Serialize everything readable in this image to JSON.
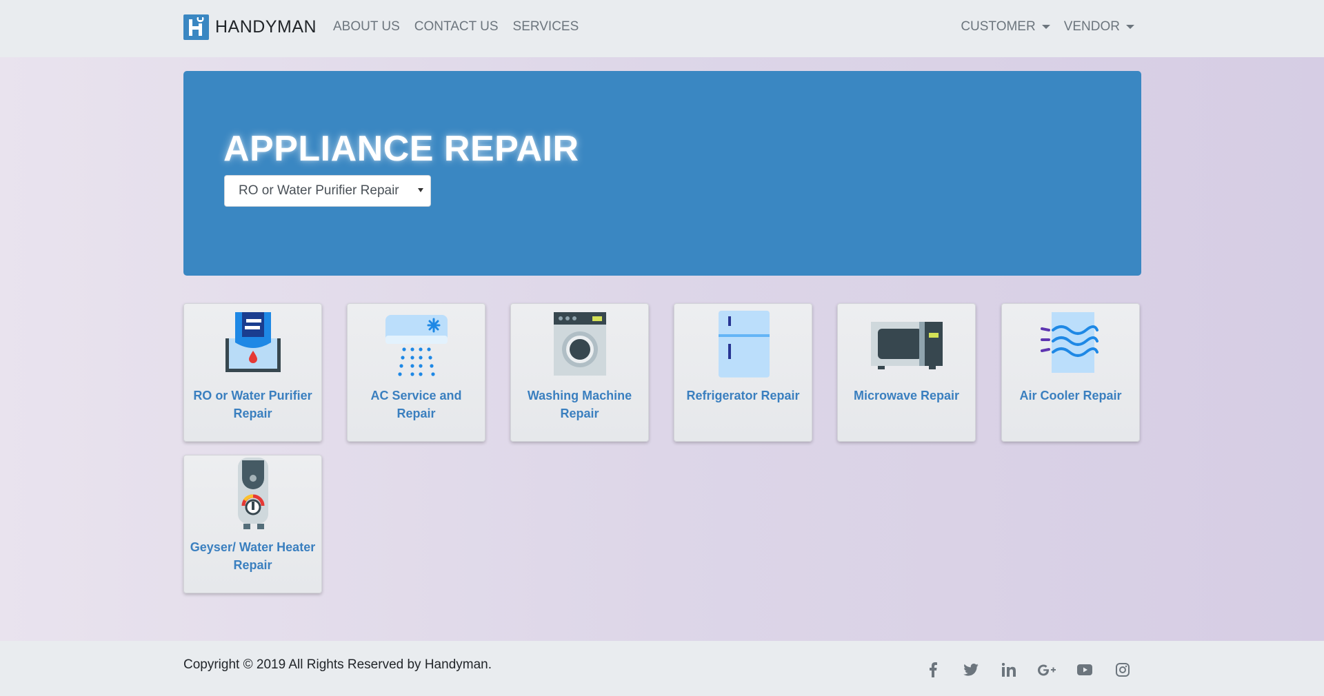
{
  "navbar": {
    "brand": "HANDYMAN",
    "links": [
      "ABOUT US",
      "CONTACT US",
      "SERVICES"
    ],
    "dropdowns": [
      "CUSTOMER",
      "VENDOR"
    ]
  },
  "hero": {
    "title": "APPLIANCE REPAIR",
    "select_value": "RO or Water Purifier Repair"
  },
  "services": [
    {
      "label": "RO or Water Purifier Repair",
      "icon": "water-purifier-icon"
    },
    {
      "label": "AC Service and Repair",
      "icon": "air-conditioner-icon"
    },
    {
      "label": "Washing Machine Repair",
      "icon": "washing-machine-icon"
    },
    {
      "label": "Refrigerator Repair",
      "icon": "refrigerator-icon"
    },
    {
      "label": "Microwave Repair",
      "icon": "microwave-icon"
    },
    {
      "label": "Air Cooler Repair",
      "icon": "air-cooler-icon"
    },
    {
      "label": "Geyser/ Water Heater Repair",
      "icon": "water-heater-icon"
    }
  ],
  "footer": {
    "copyright": "Copyright © 2019 All Rights Reserved by Handyman.",
    "socials": [
      "facebook-icon",
      "twitter-icon",
      "linkedin-icon",
      "google-plus-icon",
      "youtube-icon",
      "instagram-icon"
    ]
  },
  "colors": {
    "primary": "#3a87c2",
    "link": "#3a7fbf",
    "navbar_bg": "#e9ecef",
    "nav_text": "#6c757d"
  }
}
